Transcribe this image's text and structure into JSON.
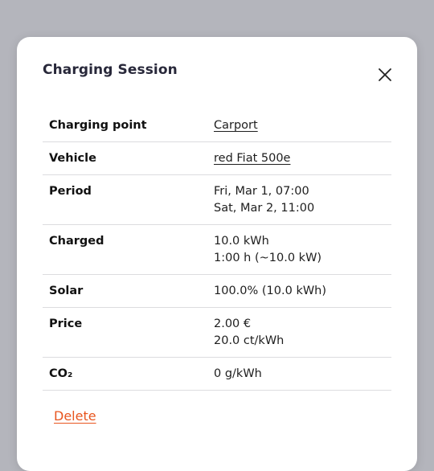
{
  "dialog": {
    "title": "Charging Session",
    "close_icon": "close-icon",
    "delete_label": "Delete"
  },
  "rows": {
    "charging_point": {
      "label": "Charging point",
      "value": "Carport"
    },
    "vehicle": {
      "label": "Vehicle",
      "value": "red Fiat 500e"
    },
    "period": {
      "label": "Period",
      "start": "Fri, Mar 1, 07:00",
      "end": "Sat, Mar 2, 11:00"
    },
    "charged": {
      "label": "Charged",
      "energy": "10.0 kWh",
      "duration": "1:00 h (~10.0 kW)"
    },
    "solar": {
      "label": "Solar",
      "value": "100.0% (10.0 kWh)"
    },
    "price": {
      "label": "Price",
      "total": "2.00 €",
      "per_kwh": "20.0 ct/kWh"
    },
    "co2": {
      "label": "CO₂",
      "value": "0 g/kWh"
    }
  },
  "colors": {
    "backdrop": "#b4b5bc",
    "title": "#28283a",
    "delete": "#e8551e"
  }
}
